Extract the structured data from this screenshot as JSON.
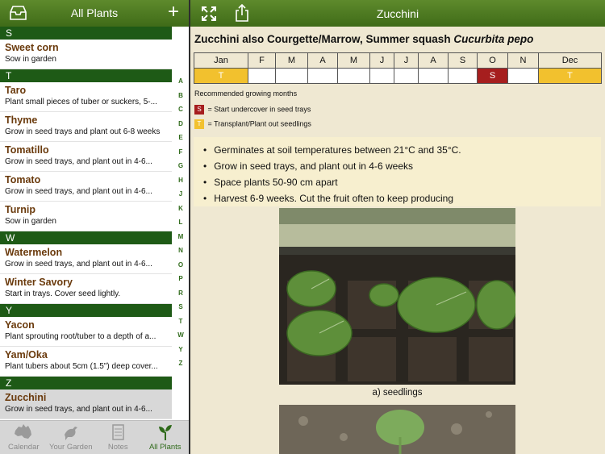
{
  "left_nav": {
    "title": "All Plants",
    "add_label": "+"
  },
  "sections": [
    {
      "letter": "S",
      "items": [
        {
          "name": "Sweet corn",
          "desc": "Sow in garden"
        }
      ]
    },
    {
      "letter": "T",
      "items": [
        {
          "name": "Taro",
          "desc": "Plant small pieces of tuber or suckers, 5-..."
        },
        {
          "name": "Thyme",
          "desc": "Grow in seed trays and plant out 6-8 weeks"
        },
        {
          "name": "Tomatillo",
          "desc": "Grow in seed trays, and plant out in 4-6..."
        },
        {
          "name": "Tomato",
          "desc": "Grow in seed trays, and plant out in 4-6..."
        },
        {
          "name": "Turnip",
          "desc": "Sow in garden"
        }
      ]
    },
    {
      "letter": "W",
      "items": [
        {
          "name": "Watermelon",
          "desc": "Grow in seed trays, and plant out in 4-6..."
        },
        {
          "name": "Winter Savory",
          "desc": "Start in trays. Cover seed lightly."
        }
      ]
    },
    {
      "letter": "Y",
      "items": [
        {
          "name": "Yacon",
          "desc": "Plant sprouting root/tuber to a depth of a..."
        },
        {
          "name": "Yam/Oka",
          "desc": "Plant tubers about 5cm (1.5\") deep cover..."
        }
      ]
    },
    {
      "letter": "Z",
      "items": [
        {
          "name": "Zucchini",
          "desc": "Grow in seed trays, and plant out in 4-6...",
          "selected": true
        }
      ]
    }
  ],
  "index_letters": [
    "A",
    "B",
    "C",
    "D",
    "E",
    "F",
    "G",
    "H",
    "J",
    "K",
    "L",
    "M",
    "N",
    "O",
    "P",
    "R",
    "S",
    "T",
    "W",
    "Y",
    "Z"
  ],
  "tabs": [
    {
      "label": "Calendar",
      "icon": "australia-map-icon",
      "active": false
    },
    {
      "label": "Your Garden",
      "icon": "bird-icon",
      "active": false
    },
    {
      "label": "Notes",
      "icon": "notes-icon",
      "active": false
    },
    {
      "label": "All Plants",
      "icon": "seedling-icon",
      "active": true
    }
  ],
  "right_nav": {
    "title": "Zucchini"
  },
  "plant": {
    "heading": "Zucchini also Courgette/Marrow, Summer squash",
    "scientific": "Cucurbita pepo",
    "months": [
      "Jan",
      "F",
      "M",
      "A",
      "M",
      "J",
      "J",
      "A",
      "S",
      "O",
      "N",
      "Dec"
    ],
    "markers": [
      "T",
      "",
      "",
      "",
      "",
      "",
      "",
      "",
      "",
      "S",
      "",
      "T"
    ],
    "recommended": "Recommended growing months",
    "legend_s_key": "S",
    "legend_s": " = Start undercover in seed trays",
    "legend_t_key": "T",
    "legend_t": " = Transplant/Plant out seedlings",
    "notes": [
      "Germinates at soil temperatures between 21°C and 35°C.",
      "Grow in seed trays, and plant out in 4-6 weeks",
      "Space plants 50-90 cm apart",
      "Harvest 6-9 weeks. Cut the fruit often to keep producing"
    ],
    "caption": "a) seedlings"
  },
  "colors": {
    "nav_green": "#4a7a1f",
    "section_green": "#1e5a16",
    "plant_name": "#6a3a0c",
    "start": "#a61e1e",
    "transplant": "#f2c12e",
    "paper": "#efe8d2"
  }
}
